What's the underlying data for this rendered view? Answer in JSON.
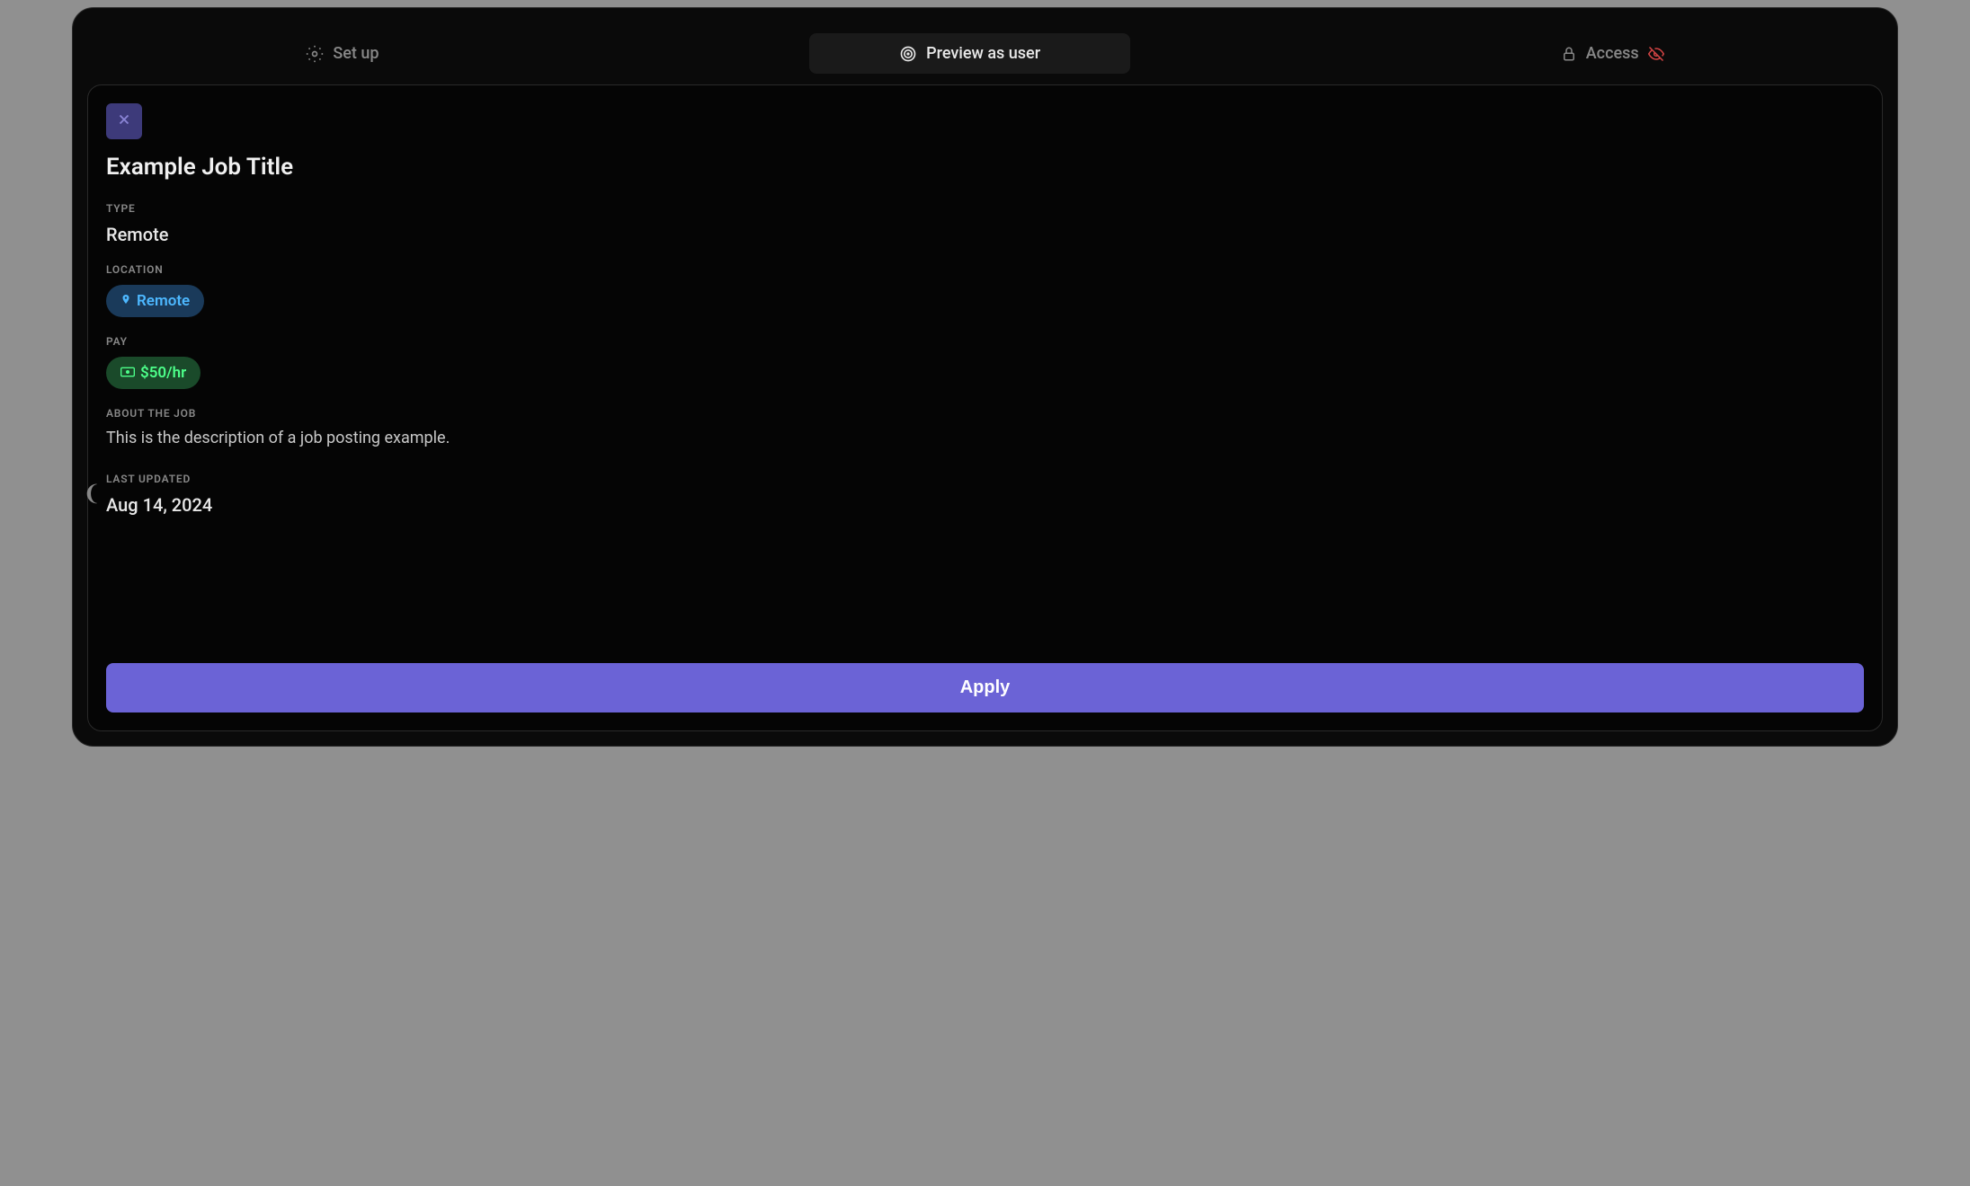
{
  "tabs": {
    "setup": "Set up",
    "preview": "Preview as user",
    "access": "Access"
  },
  "job": {
    "title": "Example Job Title",
    "type_label": "TYPE",
    "type_value": "Remote",
    "location_label": "LOCATION",
    "location_value": "Remote",
    "pay_label": "PAY",
    "pay_value": "$50/hr",
    "about_label": "ABOUT THE JOB",
    "about_value": "This is the description of a job posting example.",
    "updated_label": "LAST UPDATED",
    "updated_value": "Aug 14, 2024",
    "apply_label": "Apply"
  }
}
